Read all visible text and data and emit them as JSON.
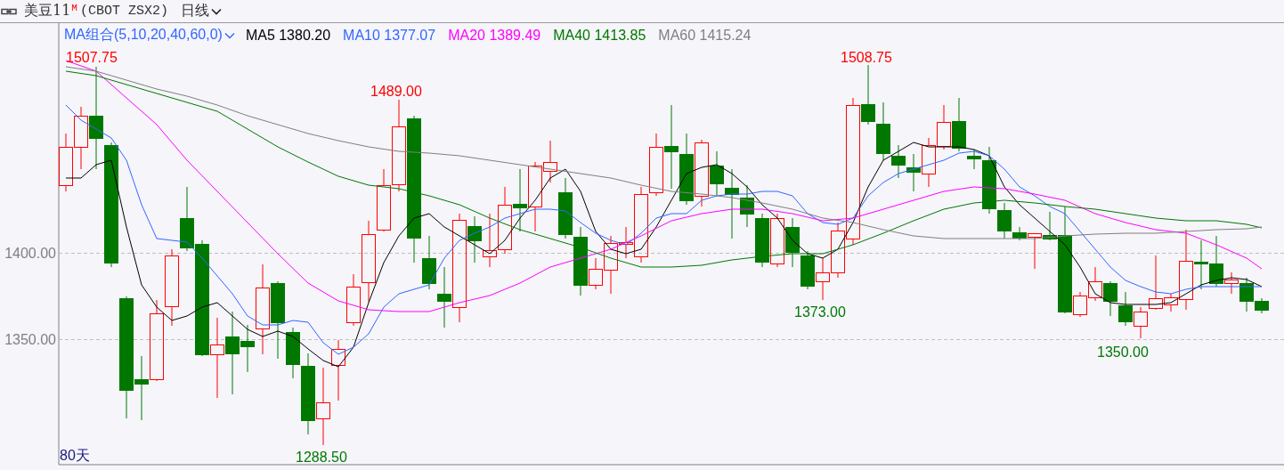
{
  "header": {
    "symbol": "美豆11",
    "symbol_superscript": "M",
    "contract": "(CBOT ZSX2)",
    "period": "日线"
  },
  "legend": {
    "group": "MA组合(5,10,20,40,60,0)",
    "averages": [
      {
        "name": "MA5",
        "value": "1380.20",
        "color": "#000000"
      },
      {
        "name": "MA10",
        "value": "1377.07",
        "color": "#3366ff"
      },
      {
        "name": "MA20",
        "value": "1389.49",
        "color": "#ff00ff"
      },
      {
        "name": "MA40",
        "value": "1413.85",
        "color": "#007800"
      },
      {
        "name": "MA60",
        "value": "1415.24",
        "color": "#808080"
      }
    ]
  },
  "y_axis": [
    "1400.00",
    "1350.00"
  ],
  "price_marks": [
    {
      "kind": "high",
      "label": "1507.75"
    },
    {
      "kind": "high",
      "label": "1489.00"
    },
    {
      "kind": "high",
      "label": "1508.75"
    },
    {
      "kind": "low",
      "label": "1373.00"
    },
    {
      "kind": "low",
      "label": "1350.00"
    },
    {
      "kind": "low",
      "label": "1288.50"
    }
  ],
  "day_count": "80天"
}
